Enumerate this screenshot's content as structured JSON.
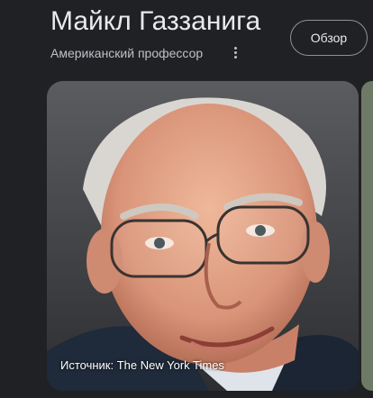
{
  "header": {
    "title": "Майкл Газзанига",
    "subtitle": "Американский профессор",
    "overview_label": "Обзор"
  },
  "photo": {
    "source_caption": "Источник: The New York Times"
  },
  "icons": {
    "more": "more-vert-icon"
  }
}
